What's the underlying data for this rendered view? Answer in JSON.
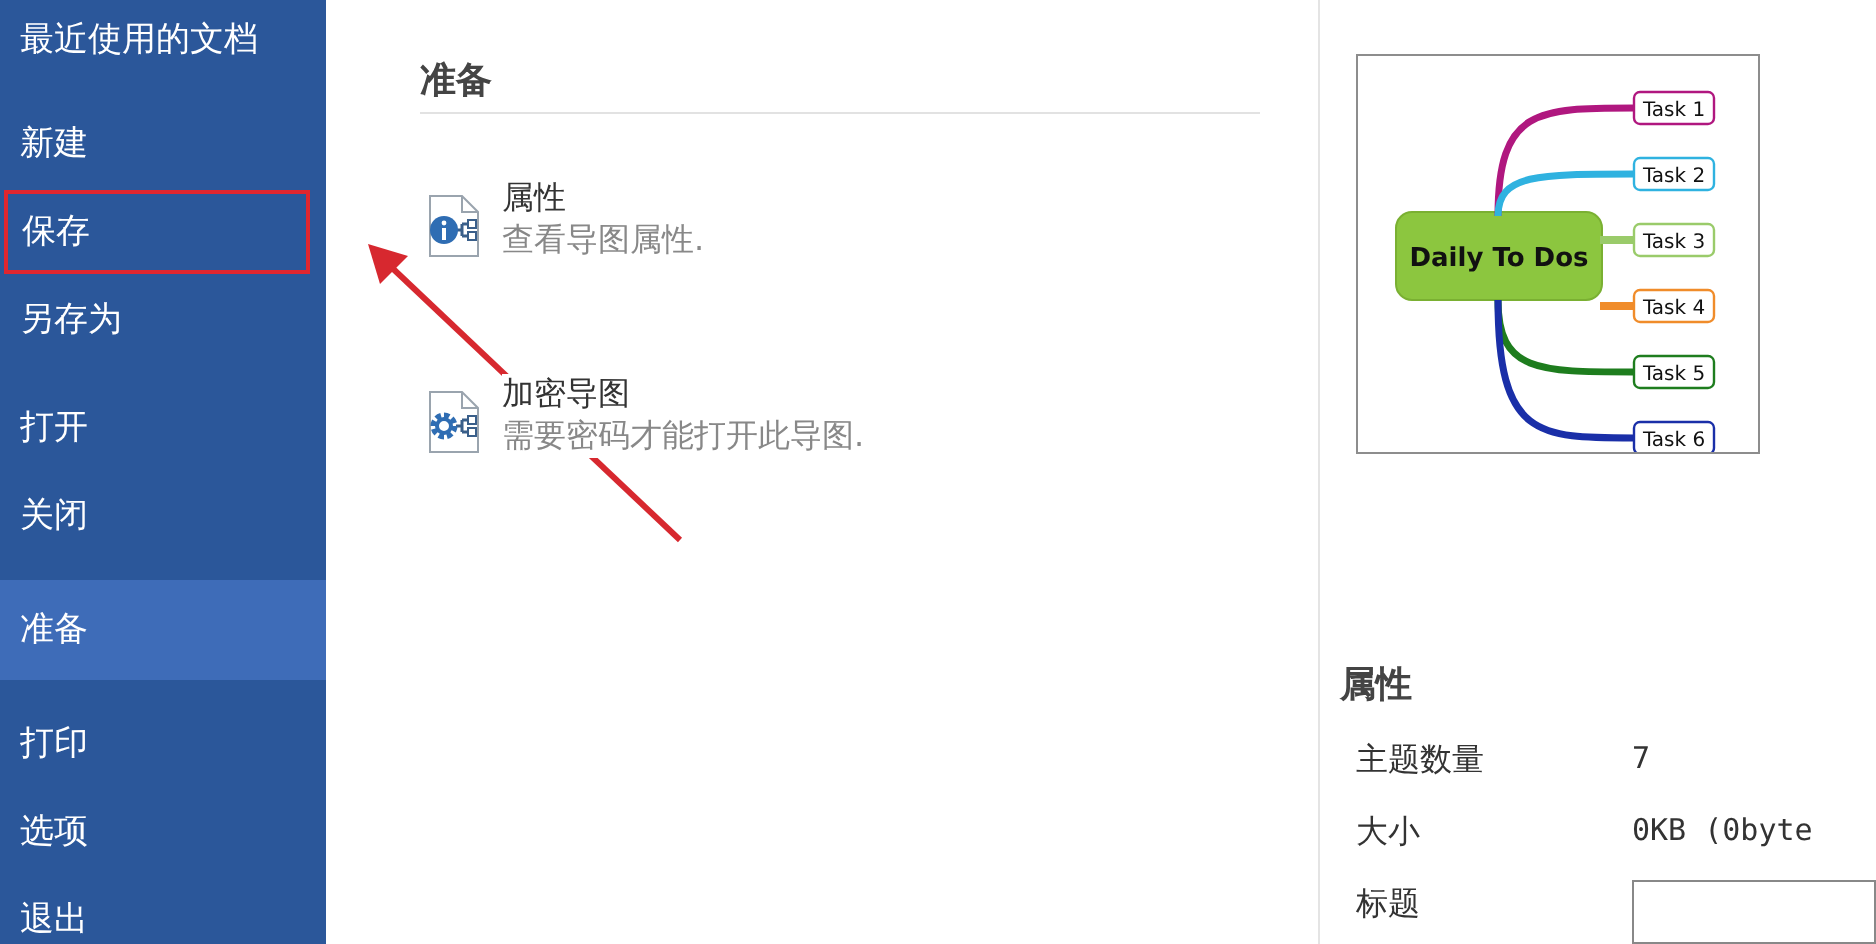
{
  "sidebar": {
    "groups": [
      [
        {
          "label": "最近使用的文档",
          "selected": false,
          "highlighted": false
        }
      ],
      [
        {
          "label": "新建",
          "selected": false,
          "highlighted": false
        },
        {
          "label": "保存",
          "selected": false,
          "highlighted": true
        },
        {
          "label": "另存为",
          "selected": false,
          "highlighted": false
        }
      ],
      [
        {
          "label": "打开",
          "selected": false,
          "highlighted": false
        },
        {
          "label": "关闭",
          "selected": false,
          "highlighted": false
        }
      ],
      [
        {
          "label": "准备",
          "selected": true,
          "highlighted": false
        }
      ],
      [
        {
          "label": "打印",
          "selected": false,
          "highlighted": false
        },
        {
          "label": "选项",
          "selected": false,
          "highlighted": false
        },
        {
          "label": "退出",
          "selected": false,
          "highlighted": false
        }
      ]
    ]
  },
  "main": {
    "heading": "准备",
    "actions": [
      {
        "kind": "info",
        "title": "属性",
        "description": "查看导图属性."
      },
      {
        "kind": "gear",
        "title": "加密导图",
        "description": "需要密码才能打开此导图."
      }
    ]
  },
  "preview": {
    "central": "Daily To Dos",
    "branches": [
      {
        "label": "Task 1",
        "color": "#b0177f"
      },
      {
        "label": "Task 2",
        "color": "#2fb2e0"
      },
      {
        "label": "Task 3",
        "color": "#9acb6a"
      },
      {
        "label": "Task 4",
        "color": "#f08c2a"
      },
      {
        "label": "Task 5",
        "color": "#1e7d1e"
      },
      {
        "label": "Task 6",
        "color": "#1a2fa8"
      }
    ]
  },
  "properties": {
    "heading": "属性",
    "rows": [
      {
        "kind": "text",
        "label": "主题数量",
        "value": "7"
      },
      {
        "kind": "text",
        "label": "大小",
        "value": "0KB (0byte"
      },
      {
        "kind": "field",
        "label": "标题"
      }
    ]
  }
}
